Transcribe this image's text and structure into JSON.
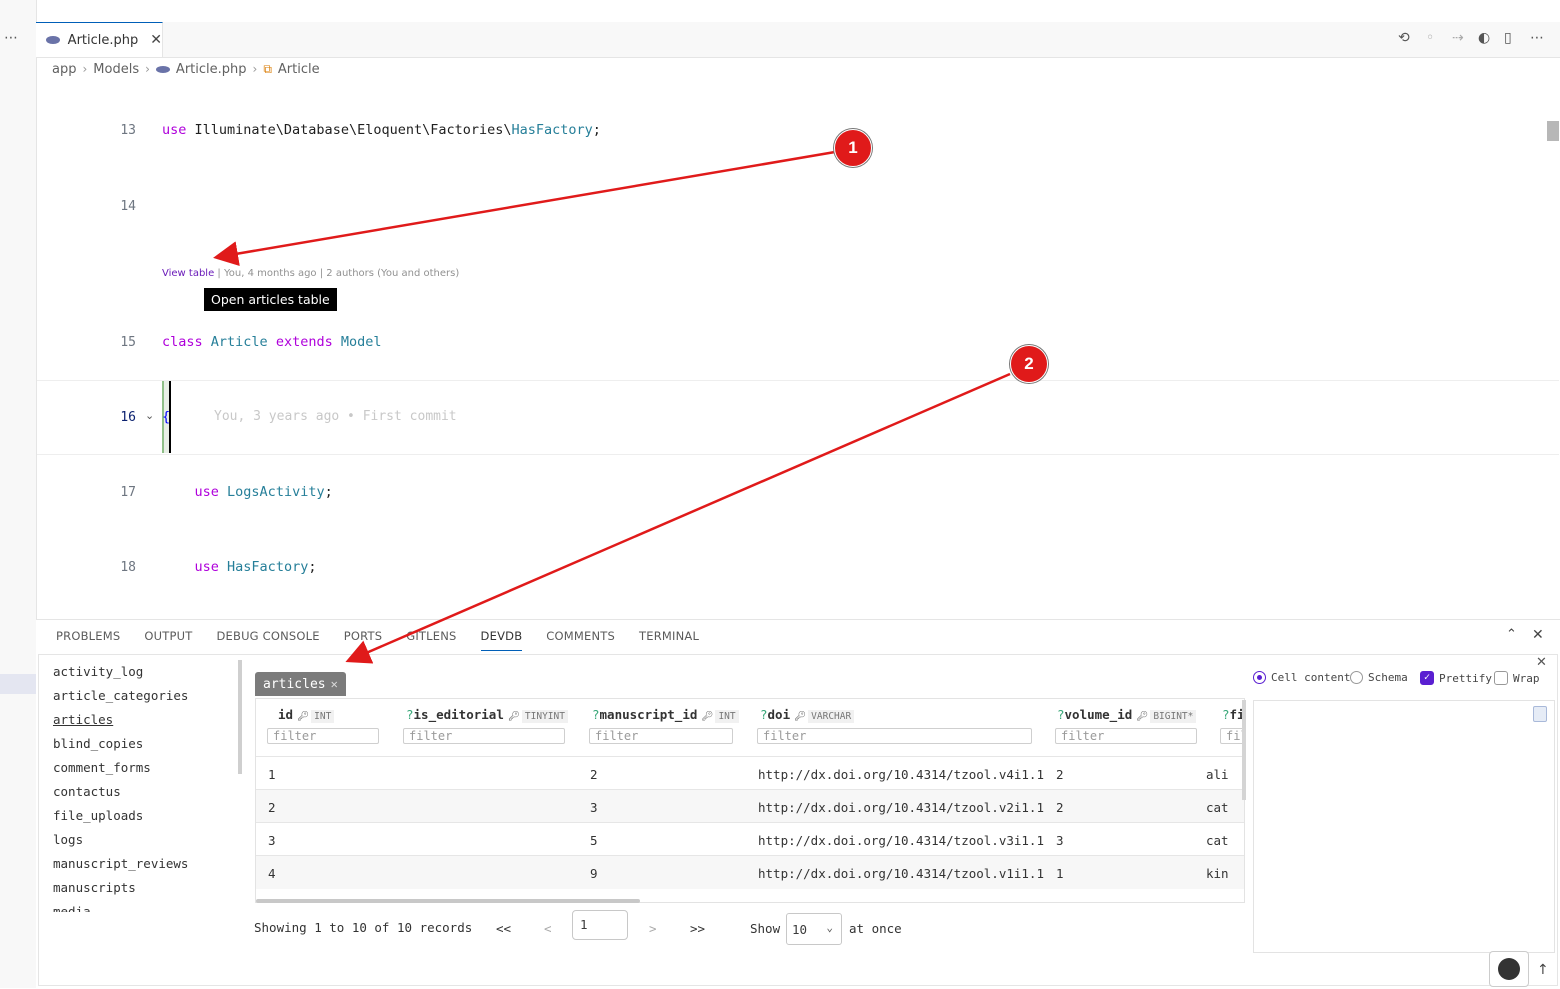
{
  "editor": {
    "tab_label": "Article.php",
    "breadcrumb": [
      "app",
      "Models",
      "Article.php",
      "Article"
    ],
    "lines": [
      {
        "num": "13",
        "code": "use Illuminate\\Database\\Eloquent\\Factories\\HasFactory;"
      },
      {
        "num": "14",
        "code": ""
      },
      {
        "num": "15",
        "code": "class Article extends Model"
      },
      {
        "num": "16",
        "code": "{"
      },
      {
        "num": "17",
        "code": "    use LogsActivity;"
      },
      {
        "num": "18",
        "code": "    use HasFactory;"
      }
    ],
    "codelens": {
      "link": "View table",
      "rest": " | You, 4 months ago | 2 authors (You and others)"
    },
    "tooltip": "Open articles table",
    "blame": "You, 3 years ago • First commit"
  },
  "panel": {
    "tabs": [
      "PROBLEMS",
      "OUTPUT",
      "DEBUG CONSOLE",
      "PORTS",
      "GITLENS",
      "DEVDB",
      "COMMENTS",
      "TERMINAL"
    ],
    "active_tab": "DEVDB"
  },
  "devdb": {
    "tables": [
      "activity_log",
      "article_categories",
      "articles",
      "blind_copies",
      "comment_forms",
      "contactus",
      "file_uploads",
      "logs",
      "manuscript_reviews",
      "manuscripts",
      "media"
    ],
    "selected_table": "articles",
    "open_tab": "articles",
    "columns": [
      {
        "name": "id",
        "type": "INT",
        "nullable": false,
        "key": true
      },
      {
        "name": "is_editorial",
        "type": "TINYINT",
        "nullable": true,
        "key": true
      },
      {
        "name": "manuscript_id",
        "type": "INT",
        "nullable": true,
        "key": true
      },
      {
        "name": "doi",
        "type": "VARCHAR",
        "nullable": true,
        "key": true
      },
      {
        "name": "volume_id",
        "type": "BIGINT*",
        "nullable": true,
        "key": true
      },
      {
        "name": "fi",
        "type": "",
        "nullable": true,
        "key": false
      }
    ],
    "filter_placeholder": "filter",
    "rows": [
      [
        "1",
        "",
        "2",
        "http://dx.doi.org/10.4314/tzool.v4i1.1",
        "2",
        "ali"
      ],
      [
        "2",
        "",
        "3",
        "http://dx.doi.org/10.4314/tzool.v2i1.1",
        "2",
        "cat"
      ],
      [
        "3",
        "",
        "5",
        "http://dx.doi.org/10.4314/tzool.v3i1.1",
        "3",
        "cat"
      ],
      [
        "4",
        "",
        "9",
        "http://dx.doi.org/10.4314/tzool.v1i1.1",
        "1",
        "kin"
      ]
    ],
    "footer": "Showing 1 to 10 of 10 records",
    "pager": {
      "first": "<<",
      "prev": "<",
      "page": "1",
      "next": ">",
      "last": ">>"
    },
    "show_label": "Show",
    "show_value": "10",
    "at_once": "at once",
    "options": {
      "cell_content": "Cell content",
      "schema": "Schema",
      "prettify": "Prettify",
      "wrap": "Wrap"
    }
  },
  "annotations": [
    "1",
    "2"
  ],
  "colors": {
    "accent": "#5a1fd1",
    "keyword": "#af00db",
    "type": "#267f99",
    "annotation": "#e01a1a"
  }
}
